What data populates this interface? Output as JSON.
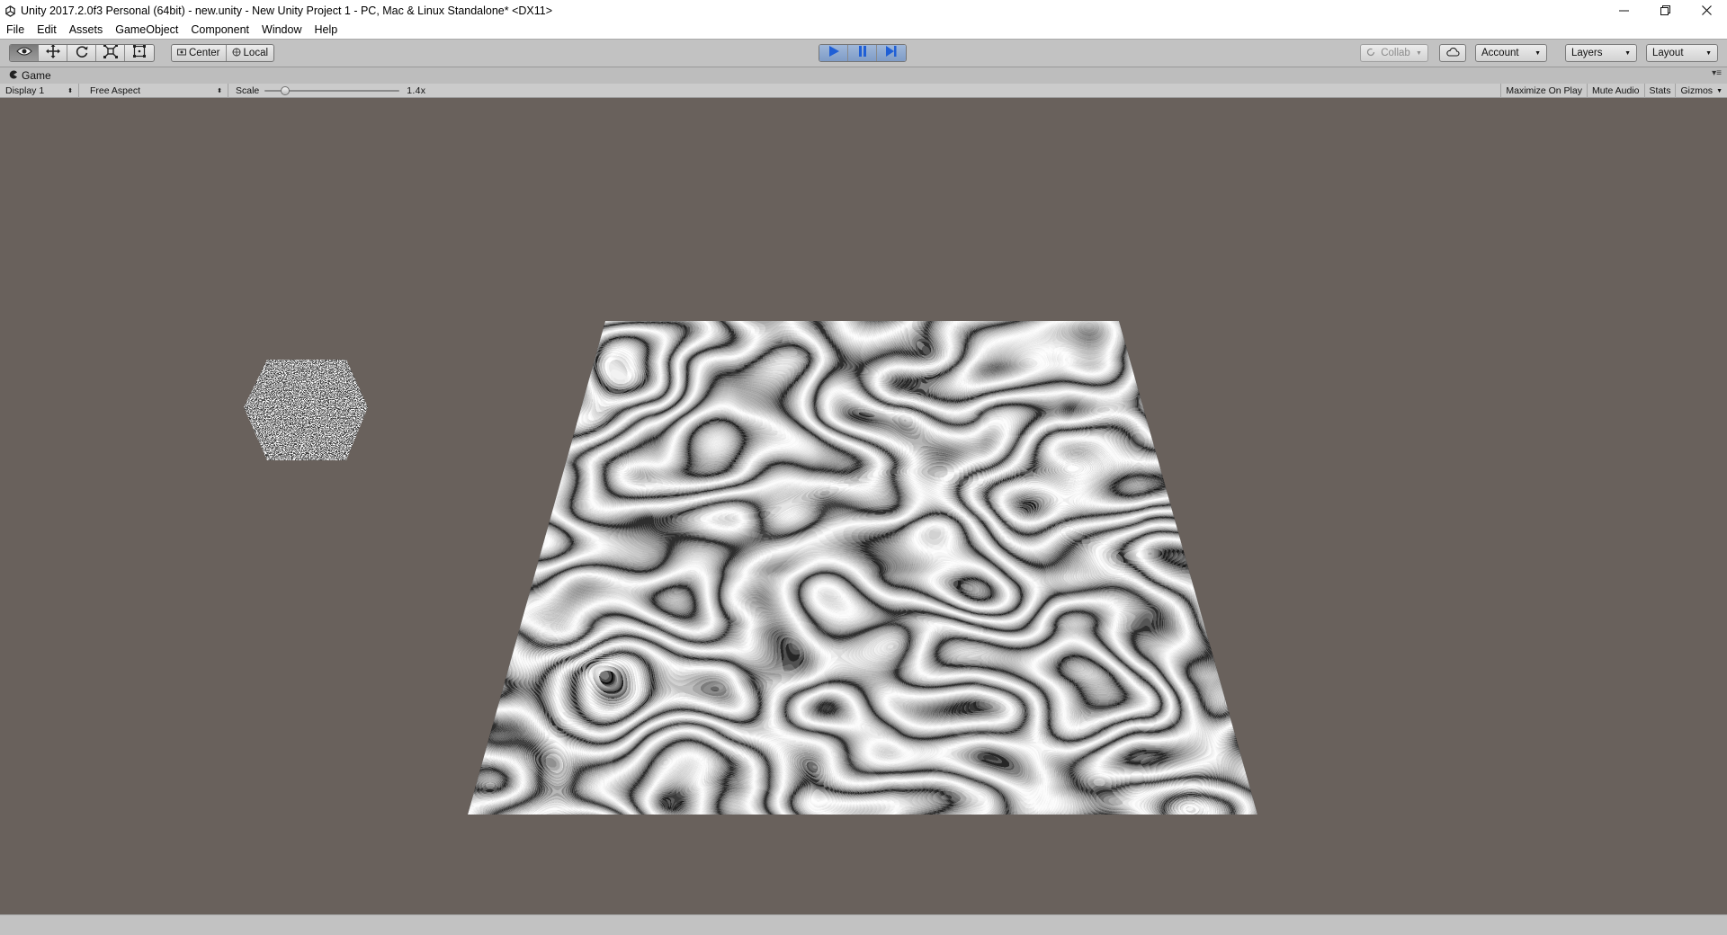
{
  "window": {
    "title": "Unity 2017.2.0f3 Personal (64bit) - new.unity - New Unity Project 1 - PC, Mac & Linux Standalone* <DX11>",
    "app_icon": "unity-logo-icon",
    "controls": [
      "minimize-icon",
      "restore-icon",
      "close-icon"
    ]
  },
  "menu": {
    "items": [
      "File",
      "Edit",
      "Assets",
      "GameObject",
      "Component",
      "Window",
      "Help"
    ]
  },
  "toolbar": {
    "transform_tools": [
      {
        "icon": "eye-icon",
        "name": "hand-tool",
        "active": true
      },
      {
        "icon": "move-icon",
        "name": "move-tool",
        "active": false
      },
      {
        "icon": "rotate-icon",
        "name": "rotate-tool",
        "active": false
      },
      {
        "icon": "scale-icon",
        "name": "scale-tool",
        "active": false
      },
      {
        "icon": "rect-icon",
        "name": "rect-tool",
        "active": false
      }
    ],
    "pivot_label": "Center",
    "space_label": "Local",
    "play": {
      "icon": "play-icon",
      "on": true
    },
    "pause": {
      "icon": "pause-icon",
      "on": true
    },
    "step": {
      "icon": "step-icon",
      "on": true
    },
    "collab_label": "Collab",
    "cloud_icon": "cloud-icon",
    "account_label": "Account",
    "layers_label": "Layers",
    "layout_label": "Layout"
  },
  "game_tab": {
    "icon": "pacman-icon",
    "label": "Game",
    "display": "Display 1",
    "aspect": "Free Aspect",
    "scale_label": "Scale",
    "scale_value": "1.4x",
    "scale_fraction": 0.13,
    "maximize_on_play": "Maximize On Play",
    "mute_audio": "Mute Audio",
    "stats": "Stats",
    "gizmos": "Gizmos"
  },
  "scene": {
    "background": "#69615c",
    "objects": [
      "noise-hexagon",
      "marble-noise-plane"
    ]
  }
}
